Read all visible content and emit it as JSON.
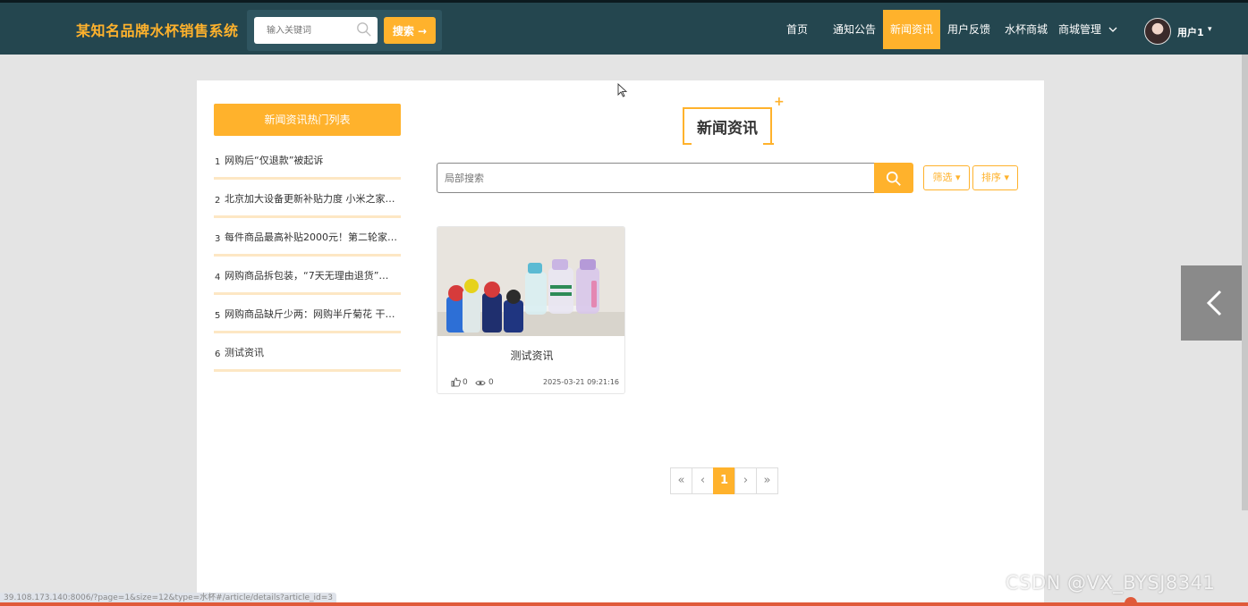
{
  "header": {
    "brand": "某知名品牌水杯销售系统",
    "search_placeholder": "输入关键词",
    "search_button": "搜索 →",
    "nav": [
      {
        "label": "首页",
        "active": false
      },
      {
        "label": "通知公告",
        "active": false
      },
      {
        "label": "新闻资讯",
        "active": true
      },
      {
        "label": "用户反馈",
        "active": false
      },
      {
        "label": "水杯商城",
        "active": false
      },
      {
        "label": "商城管理",
        "active": false
      }
    ],
    "user_name": "用户1"
  },
  "sidebar": {
    "title": "新闻资讯热门列表",
    "items": [
      {
        "num": "1",
        "text": "网购后“仅退款”被起诉"
      },
      {
        "num": "2",
        "text": "北京加大设备更新补贴力度 小米之家…"
      },
      {
        "num": "3",
        "text": "每件商品最高补贴2000元！第二轮家…"
      },
      {
        "num": "4",
        "text": "网购商品拆包装，“7天无理由退货”不…"
      },
      {
        "num": "5",
        "text": "网购商品缺斤少两：网购半斤菊花 干…"
      },
      {
        "num": "6",
        "text": "测试资讯"
      }
    ]
  },
  "main": {
    "section_title": "新闻资讯",
    "local_search_placeholder": "局部搜索",
    "filter_label": "筛选",
    "sort_label": "排序",
    "news": [
      {
        "title": "测试资讯",
        "likes": "0",
        "views": "0",
        "date": "2025-03-21 09:21:16"
      }
    ],
    "pagination": {
      "first": "«",
      "prev": "‹",
      "current": "1",
      "next": "›",
      "last": "»"
    }
  },
  "status_url": "39.108.173.140:8006/?page=1&size=12&type=水杯#/article/details?article_id=3",
  "watermark": "CSDN @VX_BYSJ8341",
  "colors": {
    "accent": "#ffb22c",
    "header_bg": "#24464f"
  }
}
